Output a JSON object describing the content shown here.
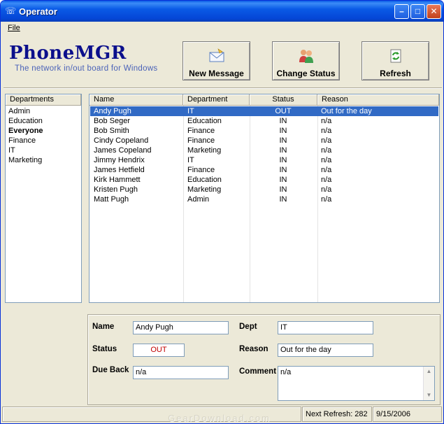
{
  "window": {
    "title": "Operator"
  },
  "menu": {
    "file_label": "File"
  },
  "header": {
    "logo": "PhoneMGR",
    "tagline": "The network in/out board for Windows"
  },
  "toolbar": {
    "new_message": "New Message",
    "change_status": "Change Status",
    "refresh": "Refresh"
  },
  "departments": {
    "header": "Departments",
    "items": [
      "Admin",
      "Education",
      "Everyone",
      "Finance",
      "IT",
      "Marketing"
    ],
    "selected": "Everyone"
  },
  "employees": {
    "columns": [
      "Name",
      "Department",
      "Status",
      "Reason"
    ],
    "rows": [
      {
        "name": "Andy Pugh",
        "dept": "IT",
        "status": "OUT",
        "reason": "Out for the day"
      },
      {
        "name": "Bob Seger",
        "dept": "Education",
        "status": "IN",
        "reason": "n/a"
      },
      {
        "name": "Bob Smith",
        "dept": "Finance",
        "status": "IN",
        "reason": "n/a"
      },
      {
        "name": "Cindy Copeland",
        "dept": "Finance",
        "status": "IN",
        "reason": "n/a"
      },
      {
        "name": "James Copeland",
        "dept": "Marketing",
        "status": "IN",
        "reason": "n/a"
      },
      {
        "name": "Jimmy Hendrix",
        "dept": "IT",
        "status": "IN",
        "reason": "n/a"
      },
      {
        "name": "James Hetfield",
        "dept": "Finance",
        "status": "IN",
        "reason": "n/a"
      },
      {
        "name": "Kirk Hammett",
        "dept": "Education",
        "status": "IN",
        "reason": "n/a"
      },
      {
        "name": "Kristen Pugh",
        "dept": "Marketing",
        "status": "IN",
        "reason": "n/a"
      },
      {
        "name": "Matt Pugh",
        "dept": "Admin",
        "status": "IN",
        "reason": "n/a"
      }
    ],
    "selected_index": 0
  },
  "details": {
    "name_label": "Name",
    "name_value": "Andy Pugh",
    "dept_label": "Dept",
    "dept_value": "IT",
    "status_label": "Status",
    "status_value": "OUT",
    "reason_label": "Reason",
    "reason_value": "Out for the day",
    "dueback_label": "Due Back",
    "dueback_value": "n/a",
    "comment_label": "Comment",
    "comment_value": "n/a"
  },
  "statusbar": {
    "next_refresh": "Next Refresh: 282",
    "date": "9/15/2006",
    "watermark": "GearDownload.com"
  },
  "colors": {
    "selection": "#316ac5",
    "out_status": "#c00000",
    "logo": "#0b0f8c",
    "titlebar": "#0a5ae6"
  }
}
